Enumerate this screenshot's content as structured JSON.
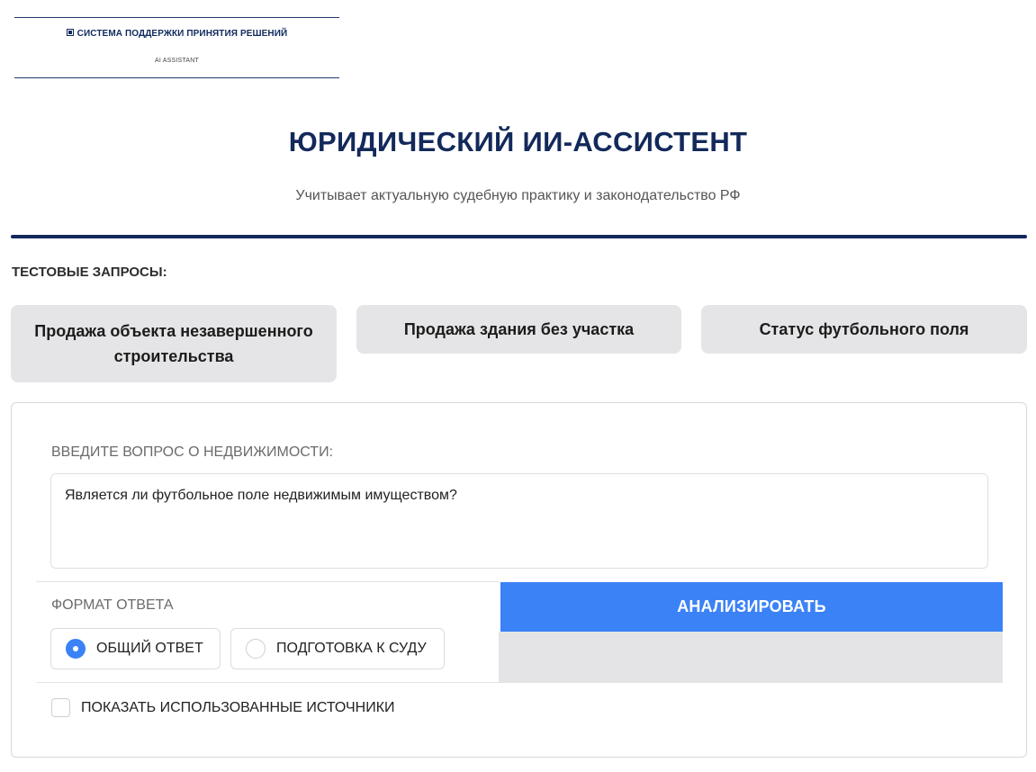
{
  "logo": {
    "title": "СИСТЕМА ПОДДЕРЖКИ ПРИНЯТИЯ РЕШЕНИЙ",
    "subtitle": "AI ASSISTANT"
  },
  "header": {
    "title": "ЮРИДИЧЕСКИЙ ИИ-АССИСТЕНТ",
    "subtitle": "Учитывает актуальную судебную практику и законодательство РФ"
  },
  "tests": {
    "label": "ТЕСТОВЫЕ ЗАПРОСЫ:",
    "buttons": [
      "Продажа объекта незавершенного строительства",
      "Продажа здания без участка",
      "Статус футбольного поля"
    ]
  },
  "form": {
    "question_label": "ВВЕДИТЕ ВОПРОС О НЕДВИЖИМОСТИ:",
    "question_value": "Является ли футбольное поле недвижимым имуществом?",
    "format_label": "ФОРМАТ ОТВЕТА",
    "format_options": [
      {
        "label": "ОБЩИЙ ОТВЕТ",
        "selected": true
      },
      {
        "label": "ПОДГОТОВКА К СУДУ",
        "selected": false
      }
    ],
    "analyze_label": "АНАЛИЗИРОВАТЬ",
    "sources_label": "ПОКАЗАТЬ ИСПОЛЬЗОВАННЫЕ ИСТОЧНИКИ",
    "sources_checked": false
  },
  "colors": {
    "brand_navy": "#13295b",
    "accent_blue": "#3b82f6",
    "button_gray": "#e5e5e7"
  }
}
